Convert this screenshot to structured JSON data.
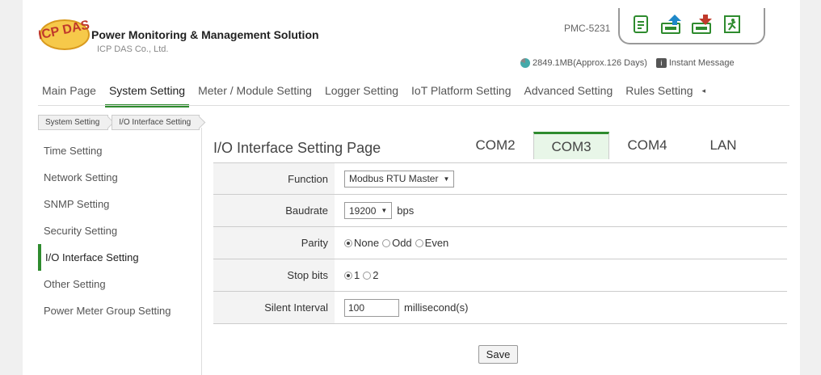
{
  "header": {
    "brand_title": "Power Monitoring & Management Solution",
    "brand_sub": "ICP DAS Co., Ltd.",
    "logo_text": "ICP DAS",
    "model": "PMC-5231",
    "storage": "2849.1MB(Approx.126 Days)",
    "message_label": "Instant Message",
    "tool_icons": [
      "document-icon",
      "upload-icon",
      "download-icon",
      "logout-icon"
    ]
  },
  "nav": {
    "items": [
      "Main Page",
      "System Setting",
      "Meter / Module Setting",
      "Logger Setting",
      "IoT Platform Setting",
      "Advanced Setting",
      "Rules Setting"
    ],
    "active": "System Setting",
    "more_arrow": "◂"
  },
  "breadcrumb": [
    "System Setting",
    "I/O Interface Setting"
  ],
  "sidebar": {
    "items": [
      "Time Setting",
      "Network Setting",
      "SNMP Setting",
      "Security Setting",
      "I/O Interface Setting",
      "Other Setting",
      "Power Meter Group Setting"
    ],
    "active": "I/O Interface Setting"
  },
  "main": {
    "title": "I/O Interface Setting Page",
    "tabs": [
      "COM2",
      "COM3",
      "COM4",
      "LAN"
    ],
    "active_tab": "COM3",
    "form": {
      "function_label": "Function",
      "function_value": "Modbus RTU Master",
      "baudrate_label": "Baudrate",
      "baudrate_value": "19200",
      "baudrate_unit": "bps",
      "parity_label": "Parity",
      "parity_options": [
        "None",
        "Odd",
        "Even"
      ],
      "parity_selected": "None",
      "stopbits_label": "Stop bits",
      "stopbits_options": [
        "1",
        "2"
      ],
      "stopbits_selected": "1",
      "silent_label": "Silent Interval",
      "silent_value": "100",
      "silent_unit": "millisecond(s)"
    },
    "save_label": "Save"
  },
  "colors": {
    "accent": "#2e8b2e",
    "active_tab_bg": "#e8f6e8"
  }
}
